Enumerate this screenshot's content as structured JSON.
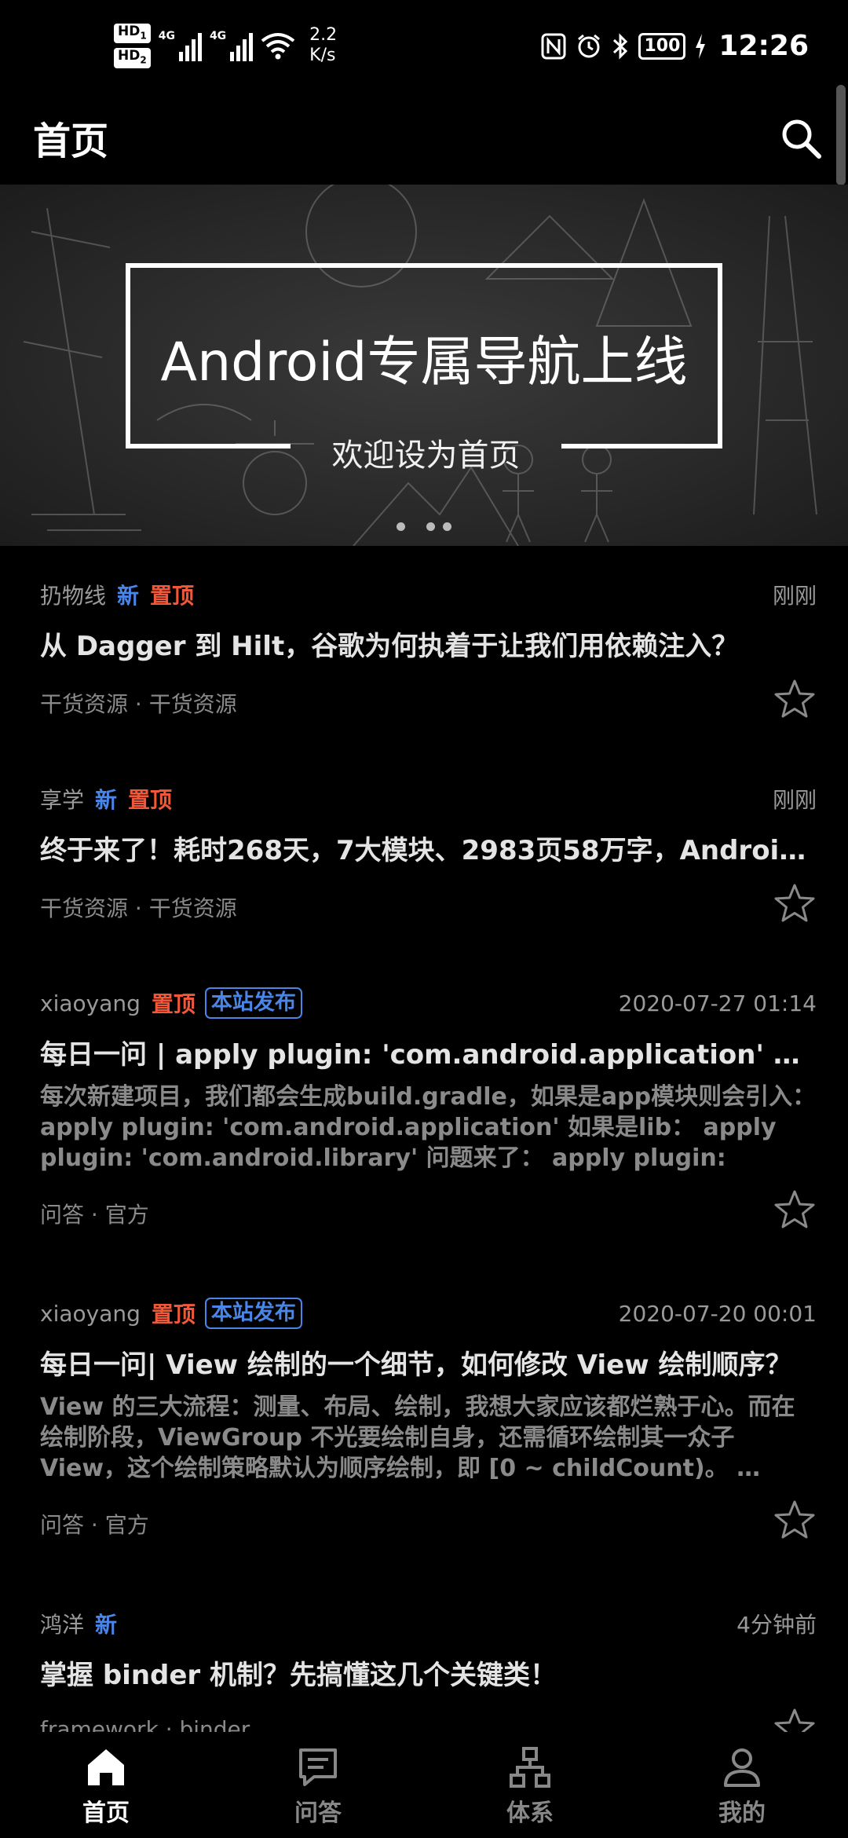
{
  "status_bar": {
    "hd1": "HD",
    "hd1_sub": "1",
    "hd2": "HD",
    "hd2_sub": "2",
    "net1": "4G",
    "net2": "4G",
    "speed_value": "2.2",
    "speed_unit": "K/s",
    "battery": "100",
    "time": "12:26"
  },
  "app_bar": {
    "title": "首页"
  },
  "banner": {
    "title": "Android专属导航上线",
    "subtitle": "欢迎设为首页",
    "page_count": 3,
    "active_index": 0
  },
  "articles": [
    {
      "author": "扔物线",
      "tag_new": "新",
      "tag_top": "置顶",
      "tag_pub": "",
      "time": "刚刚",
      "title": "从 Dagger 到 Hilt，谷歌为何执着于让我们用依赖注入？",
      "desc": "",
      "chapter": "干货资源 · 干货资源"
    },
    {
      "author": "享学",
      "tag_new": "新",
      "tag_top": "置顶",
      "tag_pub": "",
      "time": "刚刚",
      "title": "终于来了！耗时268天，7大模块、2983页58万字，Android开发核心知识笔记！",
      "desc": "",
      "chapter": "干货资源 · 干货资源"
    },
    {
      "author": "xiaoyang",
      "tag_new": "",
      "tag_top": "置顶",
      "tag_pub": "本站发布",
      "time": "2020-07-27 01:14",
      "title": "每日一问 | apply plugin: 'com.android.application' 背后发生了什么？",
      "desc": "每次新建项目，我们都会生成build.gradle，如果是app模块则会引入： apply plugin: 'com.android.application' 如果是lib： apply plugin: 'com.android.library' 问题来了： apply plugin: 'com…",
      "chapter": "问答 · 官方"
    },
    {
      "author": "xiaoyang",
      "tag_new": "",
      "tag_top": "置顶",
      "tag_pub": "本站发布",
      "time": "2020-07-20 00:01",
      "title": "每日一问| View 绘制的一个细节，如何修改 View 绘制顺序？",
      "desc": "View 的三大流程：测量、布局、绘制，我想大家应该都烂熟于心。而在绘制阶段，ViewGroup 不光要绘制自身，还需循环绘制其一众子 View，这个绘制策略默认为顺序绘制，即 [0 ~ childCount)。 …",
      "chapter": "问答 · 官方"
    },
    {
      "author": "鸿洋",
      "tag_new": "新",
      "tag_top": "",
      "tag_pub": "",
      "time": "4分钟前",
      "title": "掌握 binder 机制？先搞懂这几个关键类！",
      "desc": "",
      "chapter": "framework · binder"
    }
  ],
  "bottom_nav": [
    {
      "label": "首页",
      "icon": "home-icon",
      "active": true
    },
    {
      "label": "问答",
      "icon": "chat-icon",
      "active": false
    },
    {
      "label": "体系",
      "icon": "tree-icon",
      "active": false
    },
    {
      "label": "我的",
      "icon": "person-icon",
      "active": false
    }
  ],
  "colors": {
    "background": "#000000",
    "tag_new": "#4a86e8",
    "tag_top": "#f0583a",
    "muted": "#9a9a9a"
  }
}
